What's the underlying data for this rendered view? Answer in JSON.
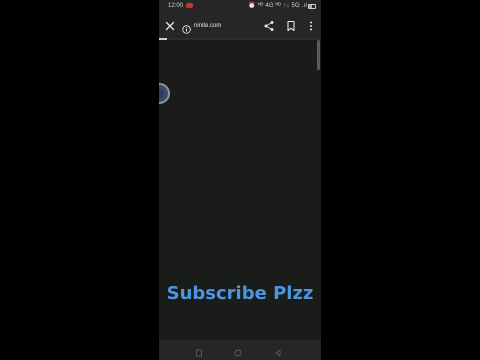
{
  "status_bar": {
    "time": "12:00",
    "right_text": "⏰ ᴴᴰ 4G ᴴᴰ ↑↓ 5G .ıl",
    "battery_level": 0.55,
    "battery_color": "#e8a13a",
    "record_color": "#c0392b"
  },
  "toolbar": {
    "close_icon": "close-icon",
    "url": "ninite.com",
    "url_icon": "info-icon",
    "share_icon": "share-icon",
    "bookmark_icon": "bookmark-icon",
    "menu_icon": "more-vert-icon"
  },
  "page_load": {
    "progress": 0.05,
    "progress_color": "#c9d0d6"
  },
  "overlay": {
    "caption": "Subscribe Plzz",
    "caption_color": "#4c95e0"
  },
  "nav_bar": {
    "recents_icon": "recents-icon",
    "home_icon": "home-circle-icon",
    "back_icon": "back-triangle-icon"
  }
}
